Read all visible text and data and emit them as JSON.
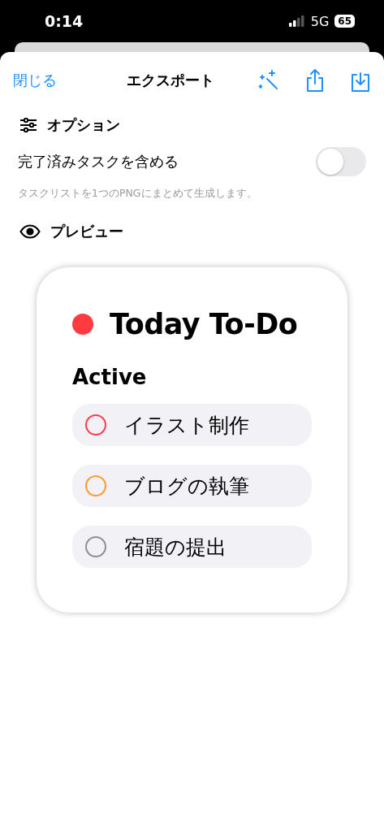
{
  "status_bar": {
    "time": "0:14",
    "network": "5G",
    "battery": "65"
  },
  "nav": {
    "close": "閉じる",
    "title": "エクスポート"
  },
  "options": {
    "title": "オプション",
    "toggle_label": "完了済みタスクを含める",
    "on": false,
    "hint": "タスクリストを1つのPNGにまとめて生成します。"
  },
  "preview": {
    "title": "プレビュー"
  },
  "card": {
    "title": "Today To-Do",
    "color": "#ff3b3f",
    "section": "Active",
    "tasks": [
      {
        "label": "イラスト制作",
        "color": "#ff3b4a"
      },
      {
        "label": "ブログの執筆",
        "color": "#ff9a2e"
      },
      {
        "label": "宿題の提出",
        "color": "#8e8e93"
      }
    ]
  }
}
